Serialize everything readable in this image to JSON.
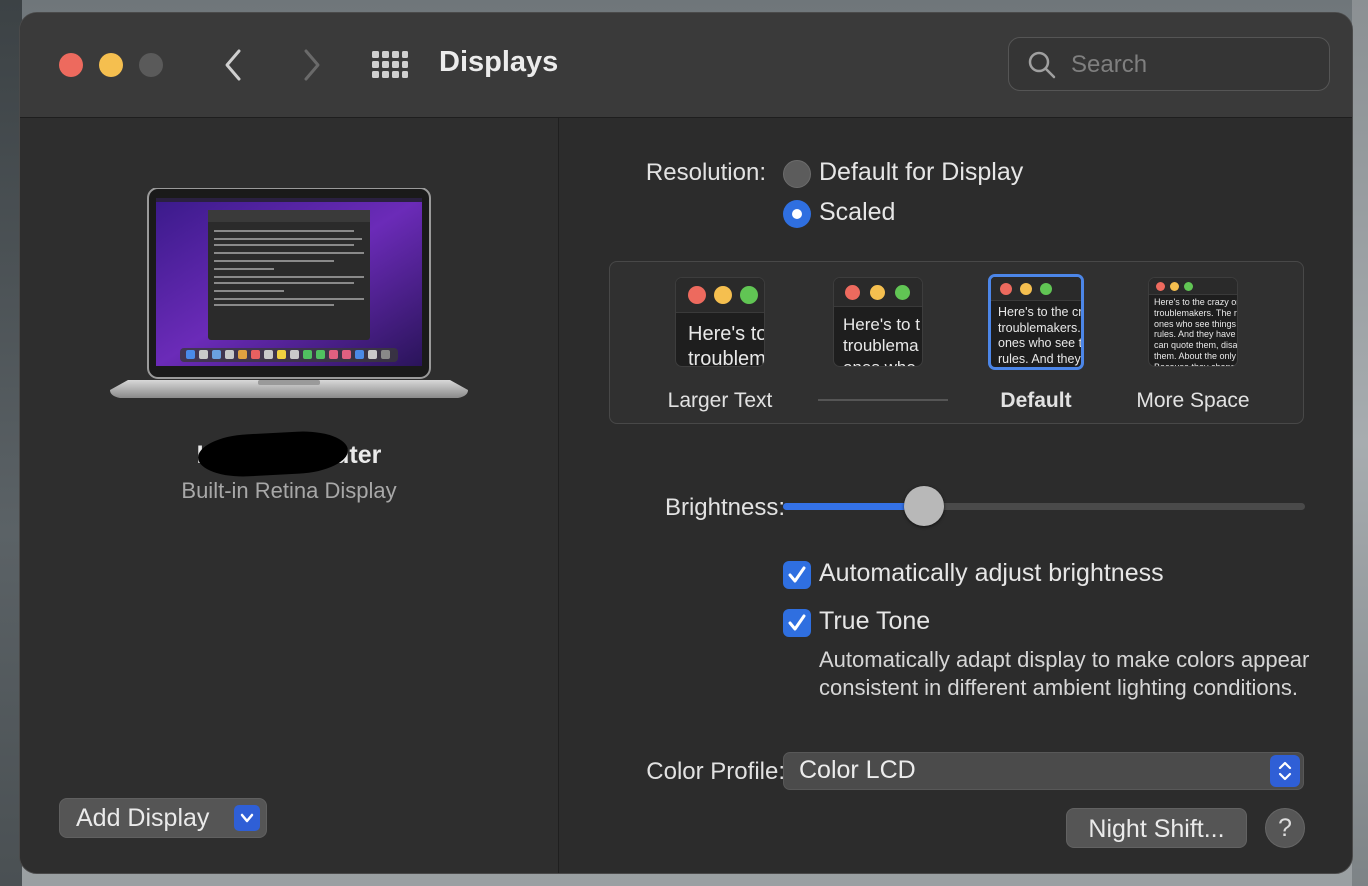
{
  "window": {
    "title": "Displays"
  },
  "search": {
    "placeholder": "Search"
  },
  "display": {
    "name": "Leon Computer",
    "subtitle": "Built-in Retina Display"
  },
  "left": {
    "add_display": "Add Display"
  },
  "resolution": {
    "label": "Resolution:",
    "options": [
      {
        "label": "Default for Display",
        "selected": false
      },
      {
        "label": "Scaled",
        "selected": true
      }
    ],
    "scales": [
      {
        "label": "Larger Text",
        "preview": "Here's to\ntroublem"
      },
      {
        "label": "",
        "preview": "Here's to t\ntroublema\nones who"
      },
      {
        "label": "Default",
        "preview": "Here's to the cr\ntroublemakers.\nones who see t\nrules. And they",
        "selected": true
      },
      {
        "label": "More Space",
        "preview": "Here's to the crazy one\ntroublemakers. The rou\nones who see things dif\nrules. And they have no\ncan quote them, disagr\nthem. About the only th\nBecause they change th"
      }
    ]
  },
  "brightness": {
    "label": "Brightness:",
    "value": 0.27
  },
  "options": {
    "auto_brightness": {
      "label": "Automatically adjust brightness",
      "checked": true
    },
    "true_tone": {
      "label": "True Tone",
      "checked": true,
      "description": "Automatically adapt display to make colors appear consistent in different ambient lighting conditions."
    }
  },
  "color_profile": {
    "label": "Color Profile:",
    "value": "Color LCD"
  },
  "buttons": {
    "night_shift": "Night Shift...",
    "help": "?"
  },
  "colors": {
    "accent": "#2f6fe0",
    "close": "#ed6a5e",
    "minimize": "#f5bf4f",
    "maximize": "#5a5a5a"
  }
}
